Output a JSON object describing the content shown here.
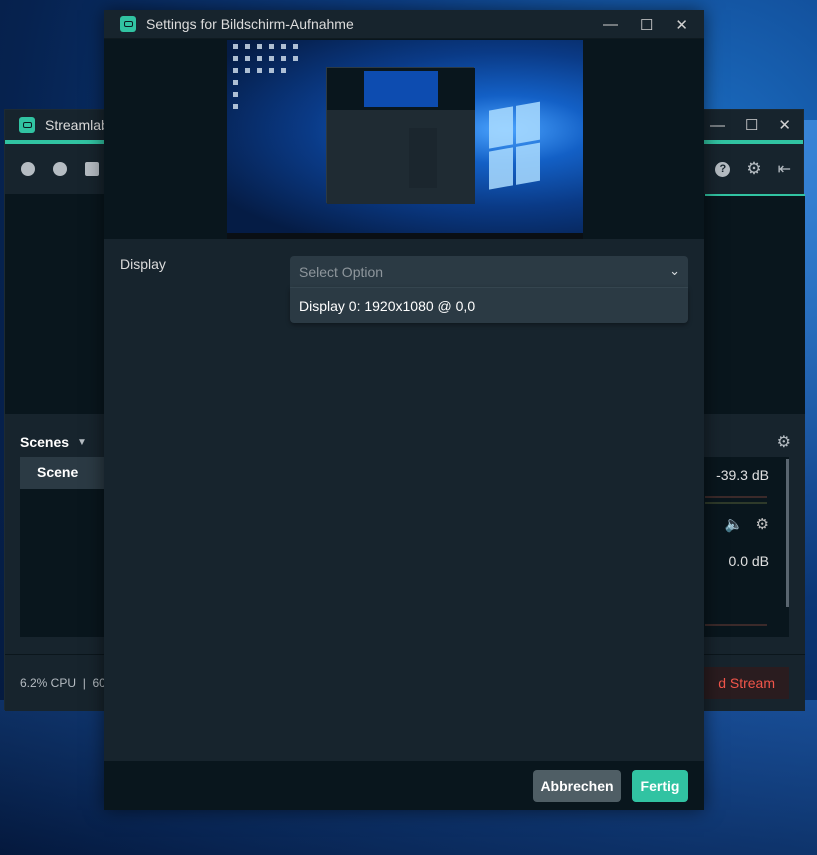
{
  "background_window": {
    "title": "Streamlabs",
    "controls": {
      "minimize": "—",
      "maximize": "☐",
      "close": "✕"
    },
    "scenes": {
      "header": "Scenes",
      "items": [
        "Scene"
      ]
    },
    "mixer": {
      "levels": [
        "-39.3 dB",
        "0.0 dB"
      ]
    },
    "footer": {
      "cpu": "6.2% CPU",
      "separator": "|",
      "fps_fragment": "60",
      "end_stream_label": "d Stream"
    }
  },
  "dialog": {
    "title": "Settings for Bildschirm-Aufnahme",
    "controls": {
      "minimize": "—",
      "maximize": "☐",
      "close": "✕"
    },
    "field": {
      "label": "Display",
      "placeholder": "Select Option",
      "options": [
        "Display 0: 1920x1080 @ 0,0"
      ]
    },
    "buttons": {
      "cancel": "Abbrechen",
      "done": "Fertig"
    }
  },
  "colors": {
    "accent": "#31c3a2",
    "panel": "#17242d",
    "dark": "#09161d",
    "danger": "#f2554a"
  }
}
